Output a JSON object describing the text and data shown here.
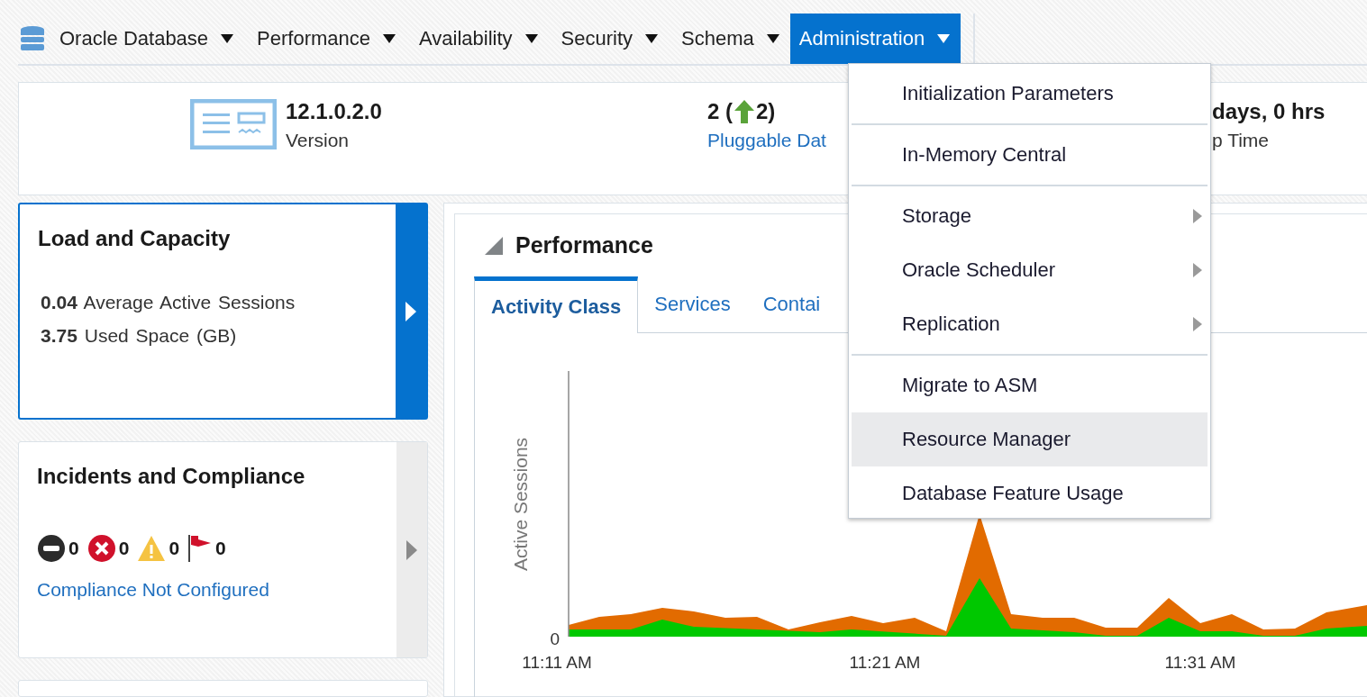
{
  "nav": [
    {
      "label": "Oracle Database",
      "kind": "database",
      "selected": false
    },
    {
      "label": "Performance",
      "selected": false
    },
    {
      "label": "Availability",
      "selected": false
    },
    {
      "label": "Security",
      "selected": false
    },
    {
      "label": "Schema",
      "selected": false
    },
    {
      "label": "Administration",
      "selected": true
    }
  ],
  "summary": {
    "version": {
      "value": "12.1.0.2.0",
      "label": "Version"
    },
    "pdbs": {
      "count": "2 (",
      "change": "2)",
      "link": "Pluggable Dat"
    },
    "uptime": {
      "value": "days, 0 hrs",
      "label": "p Time"
    }
  },
  "cards": [
    {
      "title": "Load and Capacity",
      "kind": "metrics",
      "selected": true,
      "metrics": [
        "**0.04** Average Active Sessions",
        "**3.75** Used Space (GB)"
      ]
    },
    {
      "title": "Incidents and Compliance",
      "kind": "incidents",
      "selected": false,
      "incidents": [
        {
          "kind": "blackout",
          "count": "0"
        },
        {
          "kind": "critical",
          "count": "0"
        },
        {
          "kind": "warning",
          "count": "0"
        },
        {
          "kind": "flag",
          "count": "0"
        }
      ],
      "link": "Compliance Not Configured"
    }
  ],
  "performance": {
    "title": "Performance",
    "expanded": true,
    "tabs": [
      {
        "label": "Activity Class",
        "selected": true
      },
      {
        "label": "Services",
        "selected": false
      },
      {
        "label": "Contai",
        "selected": false
      }
    ],
    "chart": {
      "ylabel": "Active Sessions",
      "y_tick": "0",
      "x_labels": [
        "11:11 AM",
        "11:21 AM",
        "11:31 AM"
      ]
    }
  },
  "menu": {
    "sections": [
      [
        {
          "label": "Initialization Parameters",
          "submenu": false,
          "selected": false
        }
      ],
      [
        {
          "label": "In-Memory Central",
          "submenu": false,
          "selected": false
        }
      ],
      [
        {
          "label": "Storage",
          "submenu": true,
          "selected": false
        },
        {
          "label": "Oracle Scheduler",
          "submenu": true,
          "selected": false
        },
        {
          "label": "Replication",
          "submenu": true,
          "selected": false
        }
      ],
      [
        {
          "label": "Migrate to ASM",
          "submenu": false,
          "selected": false
        },
        {
          "label": "Resource Manager",
          "submenu": false,
          "selected": true
        },
        {
          "label": "Database Feature Usage",
          "submenu": false,
          "selected": false
        }
      ]
    ]
  }
}
